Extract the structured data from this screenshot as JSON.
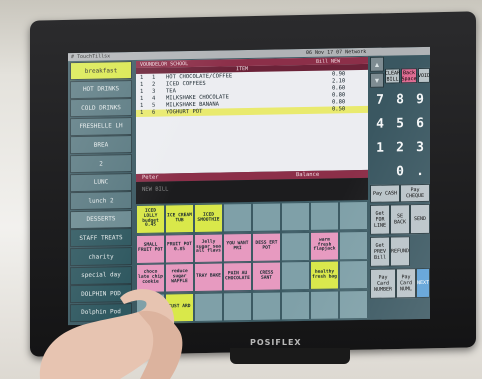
{
  "top_bar": {
    "user": "# TouchTillsx",
    "datetime": "06 Nov 17 07 Network"
  },
  "left_menu": [
    {
      "label": "breakfast",
      "color": "#d9e84a"
    },
    {
      "label": "HOT DRINKS",
      "color": "#587880"
    },
    {
      "label": "COLD DRINKS",
      "color": "#587880"
    },
    {
      "label": "FRESHELLE LH",
      "color": "#587880"
    },
    {
      "label": "BREA",
      "color": "#587880"
    },
    {
      "label": "2",
      "color": "#587880"
    },
    {
      "label": "LUNC",
      "color": "#587880"
    },
    {
      "label": "lunch 2",
      "color": "#587880"
    },
    {
      "label": "DESSERTS",
      "color": "#6b8a91"
    },
    {
      "label": "STAFF TREATS",
      "color": "#2f5860"
    },
    {
      "label": "charity",
      "color": "#2f5860"
    },
    {
      "label": "special day",
      "color": "#2f5860"
    },
    {
      "label": "DOLPHIN POD",
      "color": "#2f5860"
    },
    {
      "label": "Dolphin Pod",
      "color": "#2f5860"
    }
  ],
  "ticket": {
    "header_left": "VOUNDELOR SCHOOL",
    "header_right": "Bill NEW",
    "subheader": "ITEM",
    "items": [
      {
        "qty": "1",
        "num": "1",
        "name": "HOT CHOCOLATE/COFFEE",
        "price": "0.90"
      },
      {
        "qty": "1",
        "num": "2",
        "name": "ICED COFFEES",
        "price": "2.10"
      },
      {
        "qty": "1",
        "num": "3",
        "name": "TEA",
        "price": "0.60"
      },
      {
        "qty": "1",
        "num": "4",
        "name": "MILKSHAKE CHOCOLATE",
        "price": "0.80"
      },
      {
        "qty": "1",
        "num": "5",
        "name": "MILKSHAKE BANANA",
        "price": "0.80"
      },
      {
        "qty": "1",
        "num": "6",
        "name": "YOGHURT POT",
        "price": "0.50"
      }
    ],
    "footer_name": "Peter",
    "footer_balance": "Balance"
  },
  "message_area": {
    "text": "NEW BILL"
  },
  "right_panel": {
    "date_label": "06 Nov 17 07 Network",
    "buttons": [
      {
        "label": "CLEAR BILL",
        "color": "#b8c3c7"
      },
      {
        "label": "Back Space",
        "color": "#e06c93"
      },
      {
        "label": "VOID",
        "color": "#b8c3c7"
      },
      {
        "label": "Pay CASH",
        "color": "#b9c3c8"
      },
      {
        "label": "Pay CHEQUE",
        "color": "#b9c3c8"
      },
      {
        "label": "Get FOR LINE",
        "color": "#b9c3c8"
      },
      {
        "label": "SE BACK",
        "color": "#b9c3c8"
      },
      {
        "label": "SEND",
        "color": "#b9c3c8"
      },
      {
        "label": "Get PREV Bill",
        "color": "#b9c3c8"
      },
      {
        "label": "REFUND",
        "color": "#b9c3c8"
      },
      {
        "label": "Pay Card NUMBER",
        "color": "#b9c3c8"
      },
      {
        "label": "Pay Card NUML",
        "color": "#b9c3c8"
      },
      {
        "label": "NEXT",
        "color": "#5a9fd6"
      }
    ],
    "keypad": [
      "7",
      "8",
      "9",
      "4",
      "5",
      "6",
      "1",
      "2",
      "3",
      "0",
      "."
    ]
  },
  "product_grid": [
    {
      "label": "ICED LOLLY budget 0.45",
      "color": "#d9e84a"
    },
    {
      "label": "ICE CREAM TUB",
      "color": "#d9e84a"
    },
    {
      "label": "ICED SMOOTHIE",
      "color": "#d9e84a"
    },
    {
      "label": "",
      "color": "#7fa0a8"
    },
    {
      "label": "",
      "color": "#7fa0a8"
    },
    {
      "label": "",
      "color": "#7fa0a8"
    },
    {
      "label": "",
      "color": "#7fa0a8"
    },
    {
      "label": "",
      "color": "#7fa0a8"
    },
    {
      "label": "SMALL FRUIT POT",
      "color": "#e79ac0"
    },
    {
      "label": "FRUIT POT 0.85",
      "color": "#e79ac0"
    },
    {
      "label": "Jelly sugar sea all flavs",
      "color": "#e79ac0"
    },
    {
      "label": "YOU WANT PRI",
      "color": "#e79ac0"
    },
    {
      "label": "DESS ERT POT",
      "color": "#e79ac0"
    },
    {
      "label": "",
      "color": "#7fa0a8"
    },
    {
      "label": "warm fresh flapjack",
      "color": "#e79ac0"
    },
    {
      "label": "",
      "color": "#7fa0a8"
    },
    {
      "label": "choco late chip cookie",
      "color": "#e79ac0"
    },
    {
      "label": "reduce sugar WAFFLE",
      "color": "#e79ac0"
    },
    {
      "label": "TRAY BAKE",
      "color": "#e79ac0"
    },
    {
      "label": "PAIN AU CHOCOLATE",
      "color": "#e79ac0"
    },
    {
      "label": "CRESS SANT",
      "color": "#e79ac0"
    },
    {
      "label": "",
      "color": "#7fa0a8"
    },
    {
      "label": "healthy fresh bag",
      "color": "#d9e84a"
    },
    {
      "label": "",
      "color": "#7fa0a8"
    },
    {
      "label": "",
      "color": "#7fa0a8"
    },
    {
      "label": "CUST ARD",
      "color": "#d9e84a"
    },
    {
      "label": "",
      "color": "#7fa0a8"
    },
    {
      "label": "",
      "color": "#7fa0a8"
    },
    {
      "label": "",
      "color": "#7fa0a8"
    },
    {
      "label": "",
      "color": "#7fa0a8"
    },
    {
      "label": "",
      "color": "#7fa0a8"
    },
    {
      "label": "",
      "color": "#7fa0a8"
    }
  ],
  "brand": "POSIFLEX"
}
